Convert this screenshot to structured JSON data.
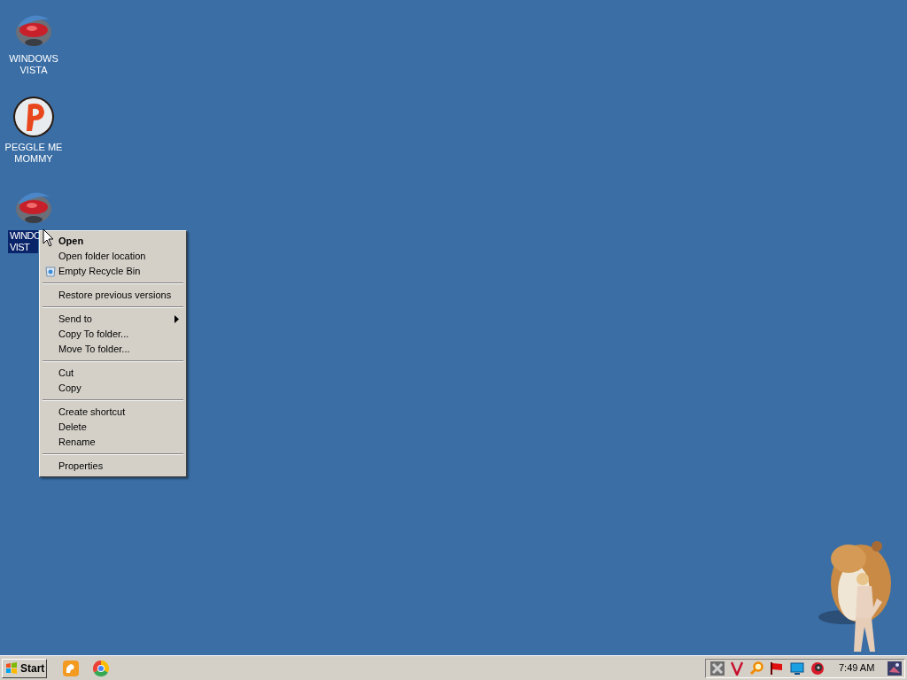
{
  "desktop_icons": [
    {
      "kind": "vista",
      "lines": [
        "WINDOWS",
        "VISTA"
      ],
      "selected": false
    },
    {
      "kind": "peggle",
      "lines": [
        "PEGGLE ME",
        "MOMMY"
      ],
      "selected": false
    },
    {
      "kind": "vista",
      "lines": [
        "WINDO",
        "VIST"
      ],
      "selected": true
    }
  ],
  "context_menu": {
    "groups": [
      [
        {
          "label": "Open",
          "default": true,
          "submenu": false,
          "icon": false
        },
        {
          "label": "Open folder location",
          "default": false,
          "submenu": false,
          "icon": false
        },
        {
          "label": "Empty Recycle Bin",
          "default": false,
          "submenu": false,
          "icon": true
        }
      ],
      [
        {
          "label": "Restore previous versions",
          "default": false,
          "submenu": false,
          "icon": false
        }
      ],
      [
        {
          "label": "Send to",
          "default": false,
          "submenu": true,
          "icon": false
        },
        {
          "label": "Copy To folder...",
          "default": false,
          "submenu": false,
          "icon": false
        },
        {
          "label": "Move To folder...",
          "default": false,
          "submenu": false,
          "icon": false
        }
      ],
      [
        {
          "label": "Cut",
          "default": false,
          "submenu": false,
          "icon": false
        },
        {
          "label": "Copy",
          "default": false,
          "submenu": false,
          "icon": false
        }
      ],
      [
        {
          "label": "Create shortcut",
          "default": false,
          "submenu": false,
          "icon": false
        },
        {
          "label": "Delete",
          "default": false,
          "submenu": false,
          "icon": false
        },
        {
          "label": "Rename",
          "default": false,
          "submenu": false,
          "icon": false
        }
      ],
      [
        {
          "label": "Properties",
          "default": false,
          "submenu": false,
          "icon": false
        }
      ]
    ]
  },
  "taskbar": {
    "start_label": "Start",
    "clock": "7:49 AM"
  }
}
